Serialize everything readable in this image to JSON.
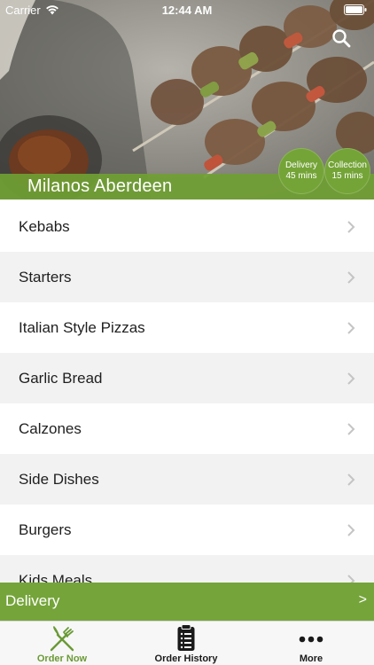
{
  "status_bar": {
    "carrier": "Carrier",
    "time": "12:44 AM"
  },
  "header": {
    "restaurant_name": "Milanos Aberdeen",
    "search_icon": "search-icon",
    "delivery_badge": {
      "title": "Delivery",
      "time": "45 mins"
    },
    "collection_badge": {
      "title": "Collection",
      "time": "15 mins"
    }
  },
  "categories": [
    {
      "label": "Kebabs"
    },
    {
      "label": "Starters"
    },
    {
      "label": "Italian Style Pizzas"
    },
    {
      "label": "Garlic Bread"
    },
    {
      "label": "Calzones"
    },
    {
      "label": "Side Dishes"
    },
    {
      "label": "Burgers"
    },
    {
      "label": "Kids Meals"
    }
  ],
  "order_bar": {
    "label": "Delivery",
    "arrow": ">"
  },
  "tab_bar": {
    "tabs": [
      {
        "label": "Order Now",
        "icon": "fork-knife-icon",
        "active": true
      },
      {
        "label": "Order History",
        "icon": "receipt-icon",
        "active": false
      },
      {
        "label": "More",
        "icon": "more-dots-icon",
        "active": false
      }
    ]
  },
  "colors": {
    "brand_green": "#75a43a",
    "active_tab": "#6a9a35"
  }
}
